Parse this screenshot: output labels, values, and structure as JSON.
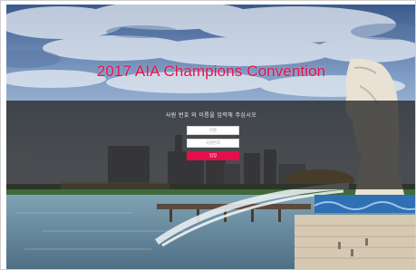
{
  "header": {
    "title": "2017 AIA Champions Convention"
  },
  "login": {
    "instruction": "사원 번호 와 이름을 입력해 주십시오",
    "name_placeholder": "이름",
    "phone_placeholder": "사원번호",
    "submit_label": "입장"
  },
  "colors": {
    "accent": "#e40e4a",
    "overlay": "#262626"
  }
}
